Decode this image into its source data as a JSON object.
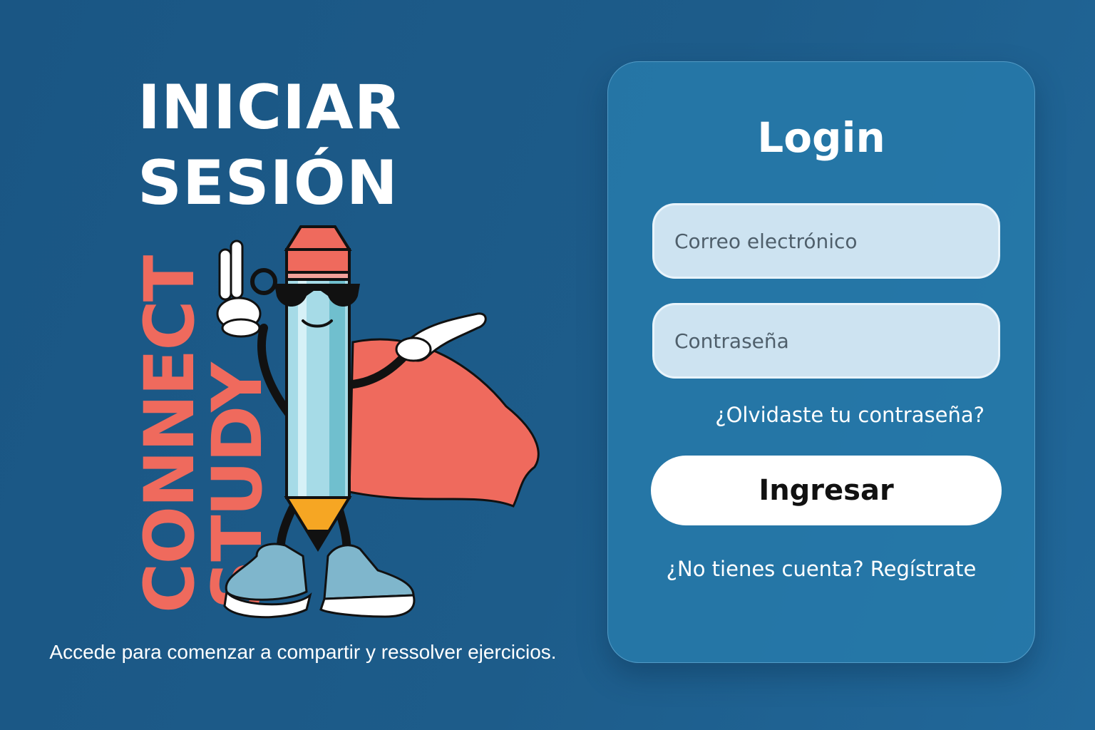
{
  "hero": {
    "title": "INICIAR\nSESIÓN",
    "brand_line1": "CONNECT",
    "brand_line2": "STUDY",
    "tagline": "Accede para comenzar a compartir y ressolver ejercicios."
  },
  "login": {
    "title": "Login",
    "email_placeholder": "Correo electrónico",
    "password_placeholder": "Contraseña",
    "forgot_label": "¿Olvidaste tu contraseña?",
    "submit_label": "Ingresar",
    "register_label": "¿No tienes cuenta? Regístrate"
  },
  "colors": {
    "background": "#1a5684",
    "card": "#277aaa",
    "accent": "#ef6a5d",
    "input": "#cde3f1",
    "button": "#ffffff"
  },
  "icons": {
    "mascot": "pencil-mascot-illustration"
  }
}
